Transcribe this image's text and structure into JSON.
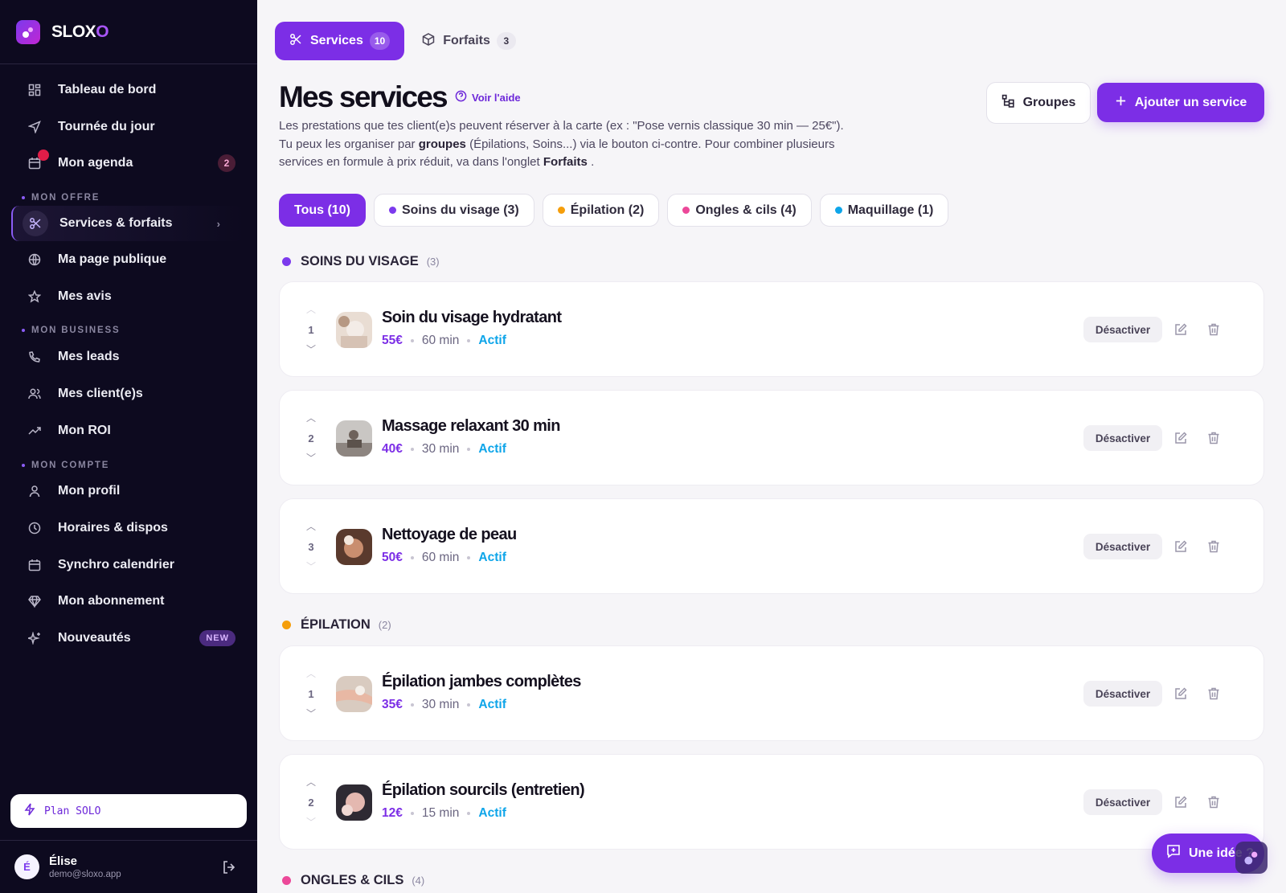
{
  "brand": {
    "name_main": "SLOX",
    "name_accent": "O"
  },
  "sidebar": {
    "items": [
      {
        "label": "Tableau de bord",
        "icon": "dashboard-icon"
      },
      {
        "label": "Tournée du jour",
        "icon": "navigation-icon"
      },
      {
        "label": "Mon agenda",
        "icon": "calendar-icon",
        "badge": "2"
      }
    ],
    "section_offre": "MON OFFRE",
    "offre_items": [
      {
        "label": "Services & forfaits",
        "icon": "scissors-icon"
      },
      {
        "label": "Ma page publique",
        "icon": "globe-icon"
      },
      {
        "label": "Mes avis",
        "icon": "star-icon"
      }
    ],
    "section_business": "MON BUSINESS",
    "business_items": [
      {
        "label": "Mes leads",
        "icon": "phone-icon"
      },
      {
        "label": "Mes client(e)s",
        "icon": "users-icon"
      },
      {
        "label": "Mon ROI",
        "icon": "trending-up-icon"
      }
    ],
    "section_compte": "MON COMPTE",
    "compte_items": [
      {
        "label": "Mon profil",
        "icon": "user-icon"
      },
      {
        "label": "Horaires & dispos",
        "icon": "clock-icon"
      },
      {
        "label": "Synchro calendrier",
        "icon": "calendar-sync-icon"
      },
      {
        "label": "Mon abonnement",
        "icon": "diamond-icon"
      },
      {
        "label": "Nouveautés",
        "icon": "sparkles-icon",
        "badge": "NEW"
      }
    ],
    "plan": "Plan SOLO",
    "user": {
      "initial": "É",
      "name": "Élise",
      "email": "demo@sloxo.app"
    }
  },
  "tabs": [
    {
      "label": "Services",
      "count": "10"
    },
    {
      "label": "Forfaits",
      "count": "3"
    }
  ],
  "header": {
    "title": "Mes services",
    "help": "Voir l'aide",
    "desc_line1": "Les prestations que tes client(e)s peuvent réserver à la carte (ex : \"Pose vernis classique 30 min — 25€\").",
    "desc_line2_a": "Tu peux les organiser par",
    "desc_line2_b": "groupes",
    "desc_line2_c": "(Épilations, Soins...) via le bouton ci-contre. Pour combiner plusieurs",
    "desc_line3_a": "services en formule à prix réduit, va dans l'onglet",
    "desc_line3_b": "Forfaits",
    "desc_line3_c": ".",
    "btn_groups": "Groupes",
    "btn_add": "Ajouter un service"
  },
  "filters": [
    {
      "label": "Tous (10)",
      "color": ""
    },
    {
      "label": "Soins du visage (3)",
      "color": "#7c3aed"
    },
    {
      "label": "Épilation (2)",
      "color": "#f59e0b"
    },
    {
      "label": "Ongles & cils (4)",
      "color": "#ec4899"
    },
    {
      "label": "Maquillage (1)",
      "color": "#0ea5e9"
    }
  ],
  "groups": [
    {
      "name": "SOINS DU VISAGE",
      "count": "(3)",
      "color": "#7c3aed"
    },
    {
      "name": "ÉPILATION",
      "count": "(2)",
      "color": "#f59e0b"
    },
    {
      "name": "ONGLES & CILS",
      "count": "(4)",
      "color": "#ec4899"
    }
  ],
  "services": [
    {
      "order": "1",
      "name": "Soin du visage hydratant",
      "price": "55€",
      "duration": "60 min",
      "status": "Actif"
    },
    {
      "order": "2",
      "name": "Massage relaxant 30 min",
      "price": "40€",
      "duration": "30 min",
      "status": "Actif"
    },
    {
      "order": "3",
      "name": "Nettoyage de peau",
      "price": "50€",
      "duration": "60 min",
      "status": "Actif"
    },
    {
      "order": "1",
      "name": "Épilation jambes complètes",
      "price": "35€",
      "duration": "30 min",
      "status": "Actif"
    },
    {
      "order": "2",
      "name": "Épilation sourcils (entretien)",
      "price": "12€",
      "duration": "15 min",
      "status": "Actif"
    }
  ],
  "deactivate_label": "Désactiver",
  "fab": "Une idée ?"
}
